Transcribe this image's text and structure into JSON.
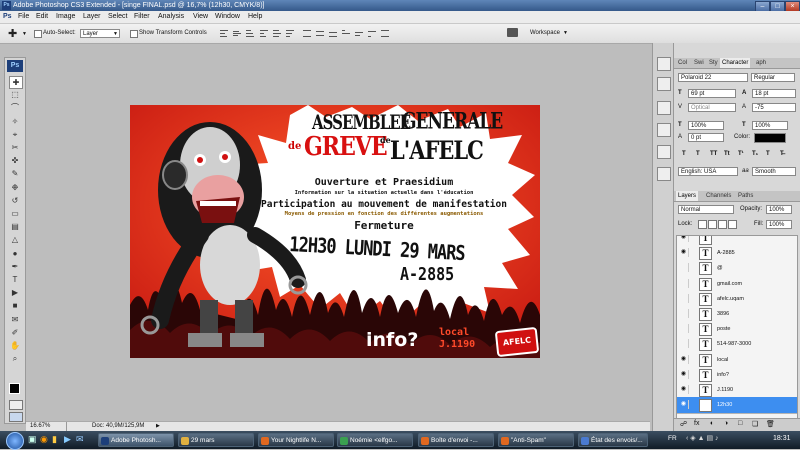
{
  "window": {
    "title": "Adobe Photoshop CS3 Extended - [singe FINAL.psd @ 16,7% (12h30, CMYK/8)]",
    "controls": [
      "–",
      "□",
      "×"
    ]
  },
  "menu": [
    "File",
    "Edit",
    "Image",
    "Layer",
    "Select",
    "Filter",
    "Analysis",
    "View",
    "Window",
    "Help"
  ],
  "options": {
    "auto_select_label": "Auto-Select:",
    "auto_select_value": "Layer",
    "show_transform_label": "Show Transform Controls",
    "workspace_label": "Workspace"
  },
  "toolbox": {
    "badge": "Ps",
    "tools": [
      "move-tool-icon",
      "marquee-tool-icon",
      "lasso-tool-icon",
      "magic-wand-icon",
      "crop-tool-icon",
      "slice-tool-icon",
      "healing-brush-icon",
      "brush-tool-icon",
      "clone-stamp-icon",
      "history-brush-icon",
      "eraser-icon",
      "gradient-tool-icon",
      "blur-tool-icon",
      "dodge-tool-icon",
      "pen-tool-icon",
      "type-tool-icon",
      "path-selection-icon",
      "shape-tool-icon",
      "notes-tool-icon",
      "eyedropper-icon",
      "hand-tool-icon",
      "zoom-tool-icon"
    ],
    "glyphs": [
      "✚",
      "⬚",
      "⌒",
      "✧",
      "⌖",
      "✂",
      "✜",
      "✎",
      "❉",
      "↺",
      "▭",
      "▤",
      "△",
      "●",
      "✒",
      "T",
      "▶",
      "■",
      "✉",
      "✐",
      "✋",
      "⌕"
    ]
  },
  "poster": {
    "title_line1a": "ASSEMBLEE",
    "title_line1b": "GENERALE",
    "title_de1": "de",
    "title_greve": "GREVE",
    "title_de2": "de",
    "title_afelc": "L'AFELC",
    "line_ouverture": "Ouverture et Praesidium",
    "line_info": "Information sur la situation actuelle dans l'éducation",
    "line_participation": "Participation au mouvement de manifestation",
    "line_moyens": "Moyens de pression en fonction des différentes augmentations",
    "line_fermeture": "Fermeture",
    "line_time": "12H30 LUNDI 29 MARS",
    "line_room": "A-2885",
    "info_q": "info?",
    "local_label": "local",
    "local_value": "J.1190",
    "logo_text": "AFELC"
  },
  "status": {
    "zoom": "16.67%",
    "doc": "Doc: 40,9M/125,9M"
  },
  "character_panel": {
    "tabs": [
      "Col",
      "Swi",
      "Sty",
      "Character",
      "aph"
    ],
    "font_family": "Polaroid 22",
    "font_style": "Regular",
    "font_size": "69 pt",
    "leading": "18 pt",
    "kerning": "Optical",
    "tracking": "-75",
    "vscale": "100%",
    "hscale": "100%",
    "baseline": "0 pt",
    "color_label": "Color:",
    "language": "English: USA",
    "aa_label": "aa",
    "antialias": "Smooth",
    "styles": [
      "T",
      "T",
      "TT",
      "Tt",
      "T¹",
      "T₁",
      "T",
      "T̶"
    ]
  },
  "layers_panel": {
    "tabs": [
      "Layers",
      "Channels",
      "Paths"
    ],
    "blend_mode": "Normal",
    "opacity_label": "Opacity:",
    "opacity": "100%",
    "lock_label": "Lock:",
    "fill_label": "Fill:",
    "fill": "100%",
    "layers": [
      {
        "name": "",
        "visible": true
      },
      {
        "name": "A-2885",
        "visible": true
      },
      {
        "name": "@",
        "visible": false
      },
      {
        "name": "gmail.com",
        "visible": false
      },
      {
        "name": "afelc.uqam",
        "visible": false
      },
      {
        "name": "3896",
        "visible": false
      },
      {
        "name": "poste",
        "visible": false
      },
      {
        "name": "514-987-3000",
        "visible": false
      },
      {
        "name": "local",
        "visible": true
      },
      {
        "name": "info?",
        "visible": true
      },
      {
        "name": "J.1190",
        "visible": true
      },
      {
        "name": "12h30",
        "visible": true
      }
    ],
    "thumb_glyph": "T",
    "eye_glyph": "◉"
  },
  "taskbar": {
    "items": [
      {
        "label": "Adobe Photosh...",
        "color": "#1d3f7a"
      },
      {
        "label": "29 mars",
        "color": "#e0b040"
      },
      {
        "label": "Your Nightlife N...",
        "color": "#e06820"
      },
      {
        "label": "Noémie <elfgo...",
        "color": "#3aa050"
      },
      {
        "label": "Boîte d'envoi -...",
        "color": "#e06820"
      },
      {
        "label": "\"Anti-Spam\"",
        "color": "#e06820"
      },
      {
        "label": "État des envois/...",
        "color": "#4a7ad0"
      }
    ],
    "lang": "FR",
    "clock": "18:31"
  },
  "colors": {
    "poster_red": "#e3301f",
    "poster_dark": "#2a0606",
    "layer_active": "#3d8ef0"
  }
}
